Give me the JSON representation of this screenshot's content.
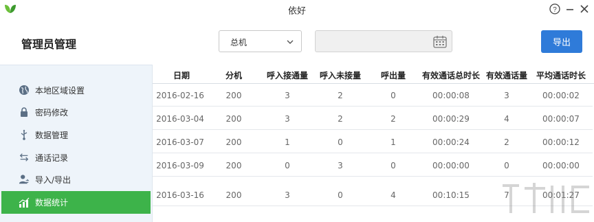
{
  "window": {
    "title": "依好"
  },
  "header": {
    "page_title": "管理员管理",
    "select_value": "总机",
    "date_value": "",
    "export_label": "导出"
  },
  "sidebar": {
    "items": [
      {
        "label": "本地区域设置",
        "icon": "globe-icon",
        "active": false
      },
      {
        "label": "密码修改",
        "icon": "lock-icon",
        "active": false
      },
      {
        "label": "数据管理",
        "icon": "usb-icon",
        "active": false
      },
      {
        "label": "通话记录",
        "icon": "transfer-arrows-icon",
        "active": false
      },
      {
        "label": "导入/导出",
        "icon": "user-transfer-icon",
        "active": false
      },
      {
        "label": "数据统计",
        "icon": "bar-chart-icon",
        "active": true
      }
    ]
  },
  "table": {
    "columns": [
      "日期",
      "分机",
      "呼入接通量",
      "呼入未接量",
      "呼出量",
      "有效通话总时长",
      "有效通话量",
      "平均通话时长"
    ],
    "rows": [
      [
        "2016-02-16",
        "200",
        "3",
        "2",
        "0",
        "00:00:08",
        "3",
        "00:00:02"
      ],
      [
        "2016-03-04",
        "200",
        "3",
        "2",
        "2",
        "00:00:29",
        "4",
        "00:00:07"
      ],
      [
        "2016-03-07",
        "200",
        "1",
        "0",
        "1",
        "00:00:24",
        "2",
        "00:00:12"
      ],
      [
        "2016-03-09",
        "200",
        "0",
        "3",
        "0",
        "00:00:00",
        "0",
        "00:00:00"
      ],
      [
        "2016-03-16",
        "200",
        "3",
        "0",
        "4",
        "00:10:15",
        "7",
        "00:01:27"
      ]
    ]
  },
  "colors": {
    "accent_blue": "#2f7bd9",
    "active_green": "#3db34a",
    "sidebar_bg": "#eef4fa"
  }
}
